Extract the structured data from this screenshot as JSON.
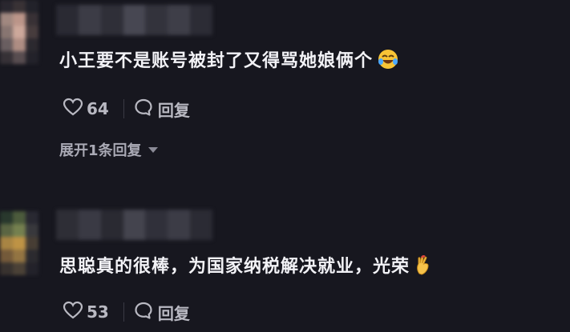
{
  "comments": [
    {
      "text": "小王要不是账号被封了又得骂她娘俩个",
      "emoji": "laughing-crying-emoji",
      "likes": "64",
      "reply_label": "回复",
      "expand_label": "展开1条回复"
    },
    {
      "text": "思聪真的很棒，为国家纳税解决就业，光荣",
      "emoji": "hand-gesture-emoji",
      "likes": "53",
      "reply_label": "回复"
    }
  ],
  "colors": {
    "background": "#17171f",
    "text": "#f2f2f6",
    "meta": "#b9b9c2"
  }
}
